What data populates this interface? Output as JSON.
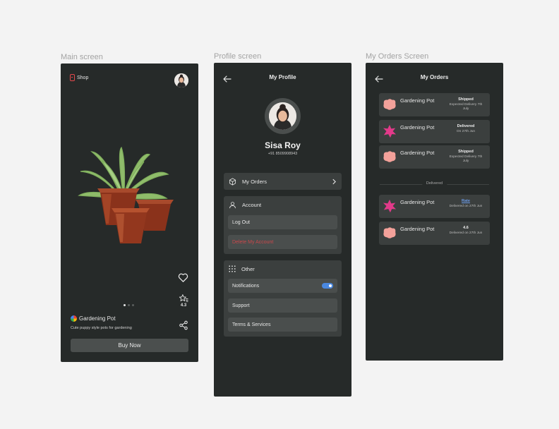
{
  "labels": {
    "main": "Main screen",
    "profile": "Profile screen",
    "orders": "My Orders Screen"
  },
  "main": {
    "brand": "Shop",
    "rating": "4.3",
    "product_name": "Gardening Pot",
    "product_desc": "Cute puppy style pots for gardening",
    "buy_label": "Buy Now",
    "carousel_active_index": 0
  },
  "profile": {
    "title": "My Profile",
    "name": "Sisa Roy",
    "phone": "+91 8509908943",
    "orders_label": "My Orders",
    "account_label": "Account",
    "logout_label": "Log Out",
    "delete_label": "Delete My Account",
    "other_label": "Other",
    "notifications_label": "Notifications",
    "notifications_on": true,
    "support_label": "Support",
    "terms_label": "Terms & Services"
  },
  "orders": {
    "title": "My Orders",
    "divider_label": "Delivered",
    "items": [
      {
        "name": "Gardening Pot",
        "status": "Shipped",
        "sub": "Expected Delivery 7th July",
        "color": "#f3a19a"
      },
      {
        "name": "Gardening Pot",
        "status": "Delivered",
        "sub": "On 27th Jun",
        "color": "#e23a8a"
      },
      {
        "name": "Gardening Pot",
        "status": "Shipped",
        "sub": "Expected Delivery 7th July",
        "color": "#f3a19a"
      },
      {
        "name": "Gardening Pot",
        "status": "Rate",
        "sub": "Delivered on 27th Jun",
        "color": "#e23a8a"
      },
      {
        "name": "Gardening Pot",
        "status": "4.6",
        "sub": "Delivered on 27th Jun",
        "color": "#f3a19a"
      }
    ]
  },
  "colors": {
    "screen_bg": "#262a29",
    "card_bg": "#3b3f3e",
    "accent_blue": "#4a88e0",
    "danger": "#c9484b",
    "brand_red": "#e2484c"
  }
}
